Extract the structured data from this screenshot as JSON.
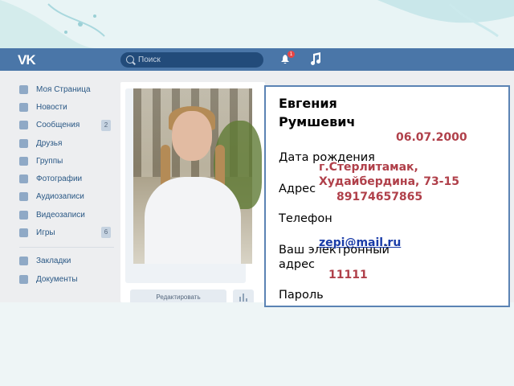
{
  "vk": {
    "logo": "VK",
    "search_placeholder": "Поиск",
    "notifications_count": "1",
    "sidebar": [
      {
        "label": "Моя Страница",
        "icon": "home-icon",
        "count": ""
      },
      {
        "label": "Новости",
        "icon": "news-icon",
        "count": ""
      },
      {
        "label": "Сообщения",
        "icon": "messages-icon",
        "count": "2"
      },
      {
        "label": "Друзья",
        "icon": "friends-icon",
        "count": ""
      },
      {
        "label": "Группы",
        "icon": "groups-icon",
        "count": ""
      },
      {
        "label": "Фотографии",
        "icon": "camera-icon",
        "count": ""
      },
      {
        "label": "Аудиозаписи",
        "icon": "music-note-icon",
        "count": ""
      },
      {
        "label": "Видеозаписи",
        "icon": "film-icon",
        "count": ""
      },
      {
        "label": "Игры",
        "icon": "gamepad-icon",
        "count": "6"
      }
    ],
    "sidebar_extra": [
      {
        "label": "Закладки",
        "icon": "star-icon"
      },
      {
        "label": "Документы",
        "icon": "document-icon"
      }
    ],
    "edit_button": "Редактировать"
  },
  "info": {
    "name_line1": "Евгения",
    "name_line2": "Румшевич",
    "birth_label": "Дата рождения",
    "birth_value": "06.07.2000",
    "address_label": "Адрес",
    "address_value_line1": "г.Стерлитамак,",
    "address_value_line2": "Худайбердина, 73-15",
    "phone_label": "Телефон",
    "phone_value": "89174657865",
    "email_label_line1": "Ваш электронный",
    "email_label_line2": "адрес",
    "email_value": "zepi@mail.ru",
    "password_label": "Пароль",
    "password_value": "11111"
  }
}
